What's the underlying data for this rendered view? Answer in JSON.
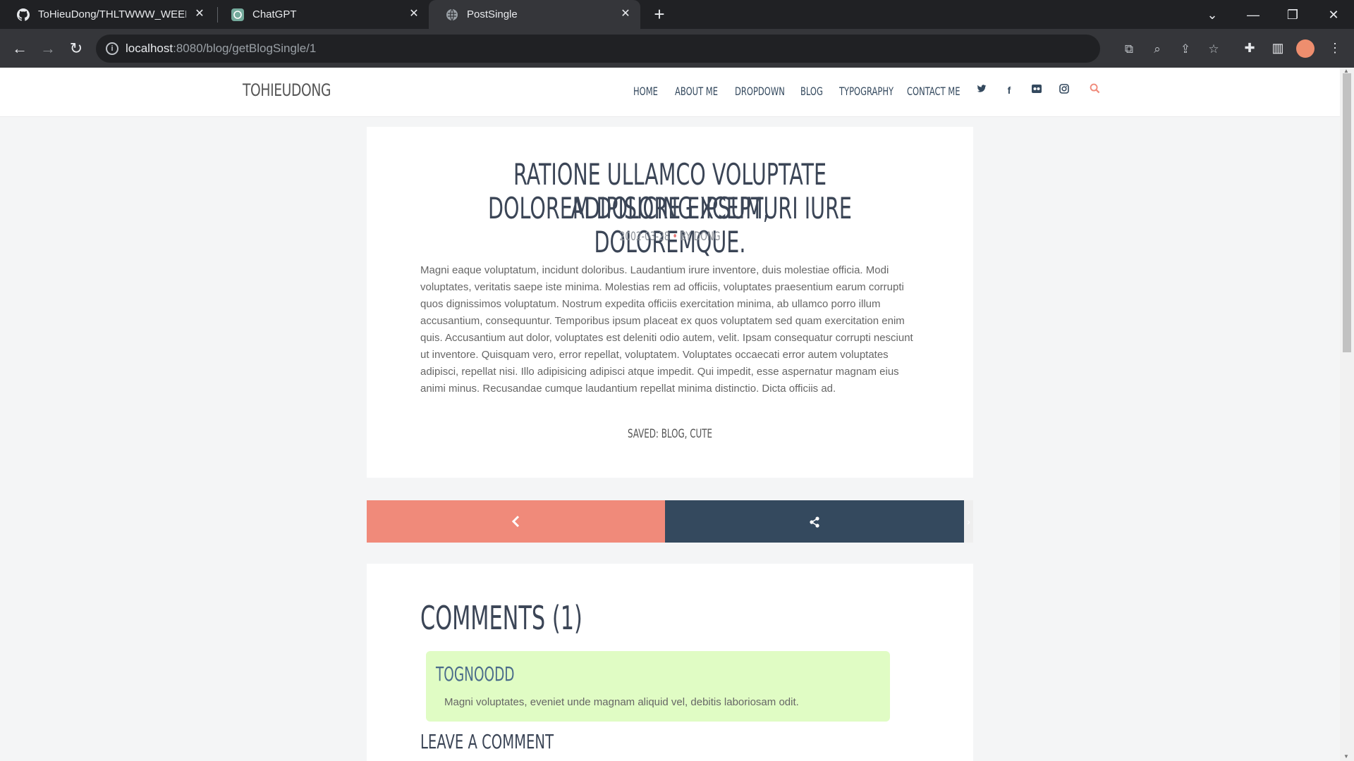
{
  "browser": {
    "tabs": [
      {
        "title": "ToHieuDong/THLTWWW_WEEK",
        "icon": "github-icon"
      },
      {
        "title": "ChatGPT",
        "icon": "chatgpt-icon"
      },
      {
        "title": "PostSingle",
        "icon": "globe-icon"
      }
    ],
    "url_host": "localhost",
    "url_path": ":8080/blog/getBlogSingle/1"
  },
  "site": {
    "brand": "TOHIEUDONG",
    "nav": [
      "HOME",
      "ABOUT ME",
      "DROPDOWN",
      "BLOG",
      "TYPOGRAPHY",
      "CONTACT ME"
    ],
    "social_icons": [
      "twitter-icon",
      "facebook-icon",
      "flickr-icon",
      "instagram-icon",
      "search-icon"
    ],
    "accent_color": "#f08a7a",
    "dark_color": "#34495e"
  },
  "post": {
    "title_line1": "RATIONE ULLAMCO VOLUPTATE ADIPISICING IPSUM,",
    "title_line2": "DOLOREM DOLORE EXCEPTURI IURE DOLOREMQUE.",
    "date": "2002-03-28",
    "separator": "•",
    "author": "BY DONG",
    "body": "Magni eaque voluptatum, incidunt doloribus. Laudantium irure inventore, duis molestiae officia. Modi voluptates, veritatis saepe iste minima. Molestias rem ad officiis, voluptates praesentium earum corrupti quos dignissimos voluptatum. Nostrum expedita officiis exercitation minima, ab ullamco porro illum accusantium, consequuntur. Temporibus ipsum placeat ex quos voluptatem sed quam exercitation enim quis. Accusantium aut dolor, voluptates est deleniti odio autem, velit. Ipsam consequatur corrupti nesciunt ut inventore. Quisquam vero, error repellat, voluptatem. Voluptates occaecati error autem voluptates adipisci, repellat nisi. Illo adipisicing adipisci atque impedit. Qui impedit, esse aspernatur magnam eius animi minus. Recusandae cumque laudantium repellat minima distinctio. Dicta officiis ad.",
    "saved": "SAVED: BLOG, CUTE"
  },
  "comments": {
    "title": "COMMENTS (1)",
    "items": [
      {
        "author": "TOGNOODD",
        "text": "Magni voluptates, eveniet unde magnam aliquid vel, debitis laboriosam odit."
      }
    ],
    "leave_title": "LEAVE A COMMENT"
  }
}
